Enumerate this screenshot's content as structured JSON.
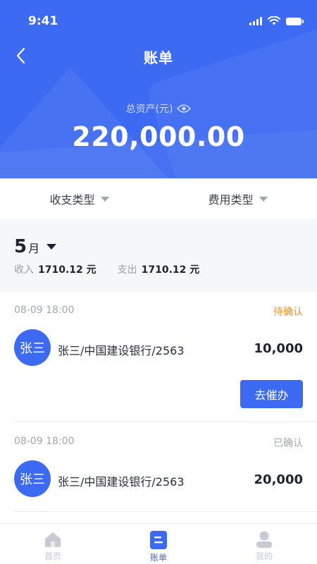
{
  "status_bar": {
    "time": "9:41"
  },
  "nav": {
    "title": "账单"
  },
  "assets": {
    "label": "总资产(元)",
    "value": "220,000.00"
  },
  "filters": [
    {
      "label": "收支类型"
    },
    {
      "label": "费用类型"
    }
  ],
  "month": {
    "number": "5",
    "suffix": "月",
    "income_label": "收入",
    "income_value": "1710.12 元",
    "expense_label": "支出",
    "expense_value": "1710.12 元"
  },
  "records": [
    {
      "time": "08-09 18:00",
      "status": "待确认",
      "status_color": "#f5922a",
      "avatar": "张三",
      "description": "张三/中国建设银行/2563",
      "amount": "10,000",
      "action": "去催办"
    },
    {
      "time": "08-09 18:00",
      "status": "已确认",
      "status_color": "#a4a7b5",
      "avatar": "张三",
      "description": "张三/中国建设银行/2563",
      "amount": "20,000"
    }
  ],
  "tabbar": [
    {
      "label": "首页",
      "icon": "home-icon"
    },
    {
      "label": "账单",
      "icon": "bill-icon"
    },
    {
      "label": "我的",
      "icon": "profile-icon"
    }
  ],
  "colors": {
    "primary": "#3c6af2",
    "tab_inactive": "#c8cad3",
    "pending": "#f5922a",
    "confirmed": "#a4a7b5"
  }
}
